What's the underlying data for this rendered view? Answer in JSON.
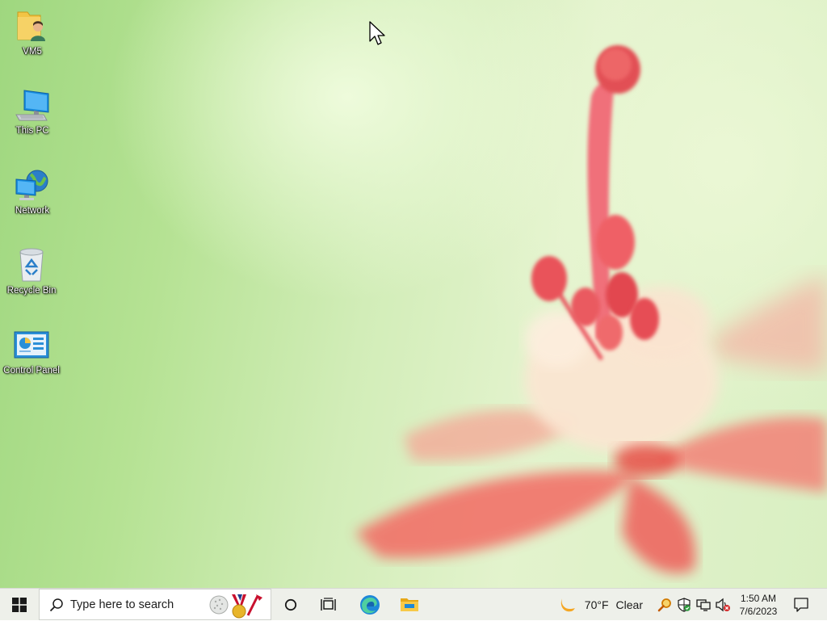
{
  "desktop": {
    "icons": [
      {
        "label": "VM5"
      },
      {
        "label": "This PC"
      },
      {
        "label": "Network"
      },
      {
        "label": "Recycle Bin"
      },
      {
        "label": "Control Panel"
      }
    ]
  },
  "taskbar": {
    "start_icon": "windows-logo-icon",
    "search": {
      "placeholder": "Type here to search"
    },
    "pinned_icons": [
      "cortana-circle-icon",
      "task-view-icon",
      "edge-browser-icon",
      "file-explorer-icon"
    ],
    "weather": {
      "temperature": "70°F",
      "condition": "Clear",
      "icon": "crescent-moon-icon"
    },
    "tray_icons": [
      "search-magnifier-icon",
      "security-shield-icon",
      "network-monitor-icon",
      "speaker-muted-icon"
    ],
    "clock": {
      "time": "1:50 AM",
      "date": "7/6/2023"
    },
    "notification_icon": "notification-bubble-icon"
  },
  "colors": {
    "taskbar_bg": "#eef0ea",
    "edge_blue": "#1e88d8",
    "folder_yellow": "#f2c445",
    "weather_moon": "#f5a623"
  }
}
